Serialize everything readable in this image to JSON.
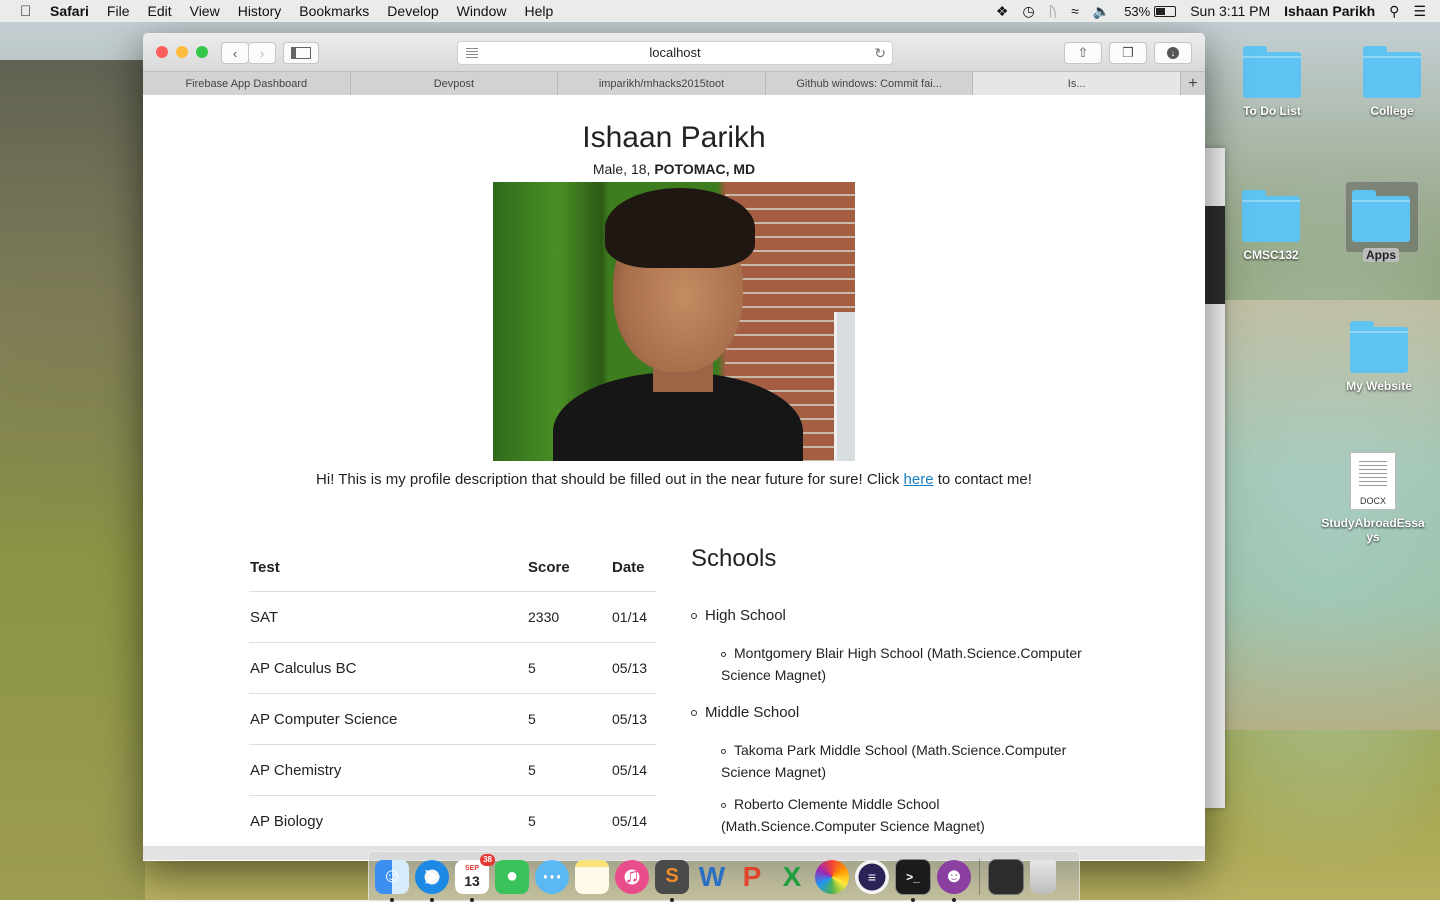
{
  "menubar": {
    "app": "Safari",
    "menus": [
      "File",
      "Edit",
      "View",
      "History",
      "Bookmarks",
      "Develop",
      "Window",
      "Help"
    ],
    "battery": "53%",
    "clock": "Sun 3:11 PM",
    "user": "Ishaan Parikh"
  },
  "desktop": {
    "icons": [
      {
        "label": "To Do List"
      },
      {
        "label": "College"
      },
      {
        "label": "CMSC132"
      },
      {
        "label": "Apps"
      },
      {
        "label": "My Website"
      },
      {
        "label": "StudyAbroadEssays",
        "ext": "DOCX"
      }
    ]
  },
  "browser": {
    "address": "localhost",
    "tabs": [
      {
        "label": "Firebase App Dashboard"
      },
      {
        "label": "Devpost"
      },
      {
        "label": "imparikh/mhacks2015toot"
      },
      {
        "label": "Github windows: Commit fai..."
      },
      {
        "label": "Is..."
      }
    ],
    "new_tab": "+"
  },
  "profile": {
    "name": "Ishaan Parikh",
    "meta_prefix": "Male, 18, ",
    "location": "POTOMAC, MD",
    "desc_before": "Hi! This is my profile description that should be filled out in the near future for sure! Click ",
    "desc_link": "here",
    "desc_after": " to contact me!"
  },
  "tests": {
    "headers": [
      "Test",
      "Score",
      "Date"
    ],
    "rows": [
      [
        "SAT",
        "2330",
        "01/14"
      ],
      [
        "AP Calculus BC",
        "5",
        "05/13"
      ],
      [
        "AP Computer Science",
        "5",
        "05/13"
      ],
      [
        "AP Chemistry",
        "5",
        "05/14"
      ],
      [
        "AP Biology",
        "5",
        "05/14"
      ]
    ]
  },
  "schools": {
    "title": "Schools",
    "high_label": "High School",
    "high_1a": "Montgomery Blair High School (Math.Science.Computer",
    "high_1b": "Science Magnet)",
    "middle_label": "Middle School",
    "middle_1a": "Takoma Park Middle School (Math.Science.Computer",
    "middle_1b": "Science Magnet)",
    "middle_2a": "Roberto Clemente Middle School",
    "middle_2b": "(Math.Science.Computer Science Magnet)"
  },
  "dock": {
    "calendar_month": "SEP",
    "calendar_day": "13",
    "badge": "38"
  },
  "colors": {
    "link": "#1a7fc2",
    "folder": "#5ec3f1",
    "close": "#fc605c",
    "minimize": "#fdbc40",
    "zoom": "#34c84a"
  }
}
